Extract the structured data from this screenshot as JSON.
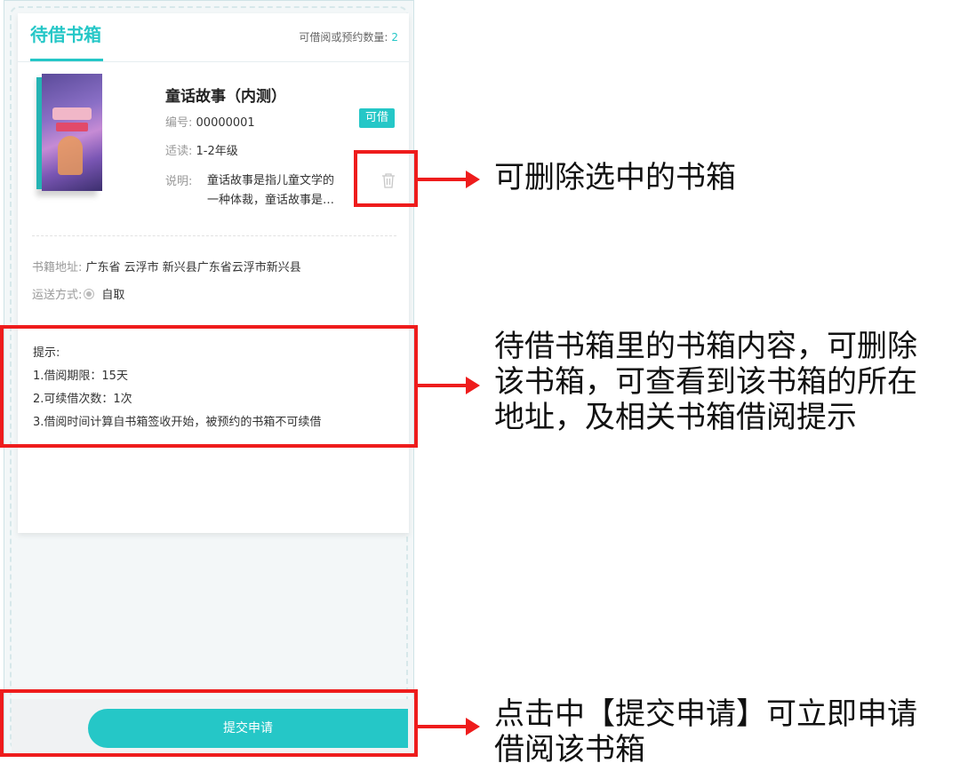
{
  "header": {
    "tab_label": "待借书箱",
    "count_label": "可借阅或预约数量:",
    "count_value": "2"
  },
  "book": {
    "title": "童话故事（内测）",
    "code_label": "编号:",
    "code_value": "00000001",
    "status": "可借",
    "grade_label": "适读:",
    "grade_value": "1-2年级",
    "desc_label": "说明:",
    "desc_value": "童话故事是指儿童文学的一种体裁，童话故事是指儿童文学的一种体裁"
  },
  "address": {
    "label": "书籍地址:",
    "value": "广东省 云浮市 新兴县广东省云浮市新兴县"
  },
  "shipping": {
    "label": "运送方式:",
    "value": "自取"
  },
  "tips": {
    "heading": "提示:",
    "items": [
      "1.借阅期限：15天",
      "2.可续借次数：1次",
      "3.借阅时间计算自书箱签收开始，被预约的书箱不可续借"
    ]
  },
  "submit_label": "提交申请",
  "annotations": {
    "delete_note": "可删除选中的书箱",
    "content_note": [
      "待借书箱里的书箱内容，可删除",
      "该书箱，可查看到该书箱的所在",
      "地址，及相关书箱借阅提示"
    ],
    "submit_note": [
      "点击中【提交申请】可立即申请",
      "借阅该书箱"
    ]
  },
  "colors": {
    "accent": "#25c7c7",
    "highlight": "#ee1c1c"
  },
  "icons": [
    "trash-icon",
    "radio-icon"
  ]
}
